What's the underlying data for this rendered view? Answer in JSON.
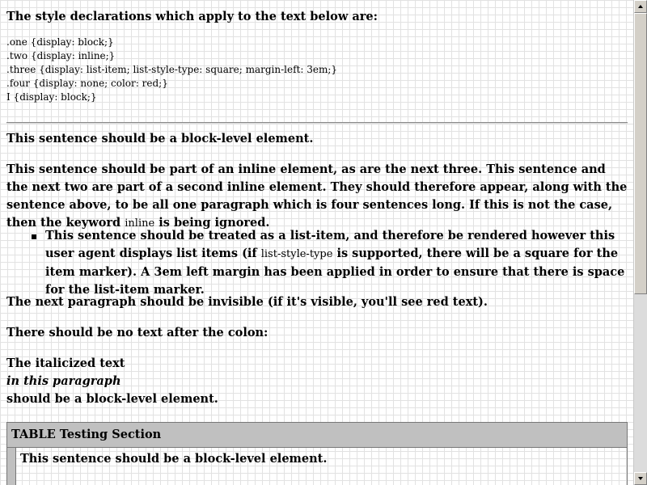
{
  "heading": "The style declarations which apply to the text below are:",
  "css_rules": [
    ".one {display: block;}",
    ".two {display: inline;}",
    ".three {display: list-item; list-style-type: square; margin-left: 3em;}",
    ".four {display: none; color: red;}",
    "I {display: block;}"
  ],
  "p_block": "This sentence should be a block-level element.",
  "p_inline": {
    "before": "This sentence should be part of an inline element, as are the next three. This sentence and the next two are part of a second inline element. They should therefore appear, along with the sentence above, to be all one paragraph which is four sentences long. If this is not the case, then the keyword ",
    "keyword": "inline",
    "after": " is being ignored."
  },
  "list_item": {
    "before": "This sentence should be treated as a list-item, and therefore be rendered however this user agent displays list items (if ",
    "keyword": "list-style-type",
    "after": " is supported, there will be a square for the item marker). A 3em left margin has been applied in order to ensure that there is space for the list-item marker."
  },
  "p_invisible": "The next paragraph should be invisible (if it's visible, you'll see red text).",
  "p_colon": "There should be no text after the colon:",
  "italic_para": {
    "line1": "The italicized text",
    "italic": "in this paragraph",
    "line3": "should be a block-level element."
  },
  "table": {
    "header": "TABLE Testing Section",
    "cell": "This sentence should be a block-level element."
  },
  "colors": {
    "background": "#ffffff",
    "grid": "#e2e2e2",
    "table_header": "#c0c0c0"
  },
  "icons": {
    "scroll_up": "triangle-up",
    "scroll_down": "triangle-down"
  }
}
